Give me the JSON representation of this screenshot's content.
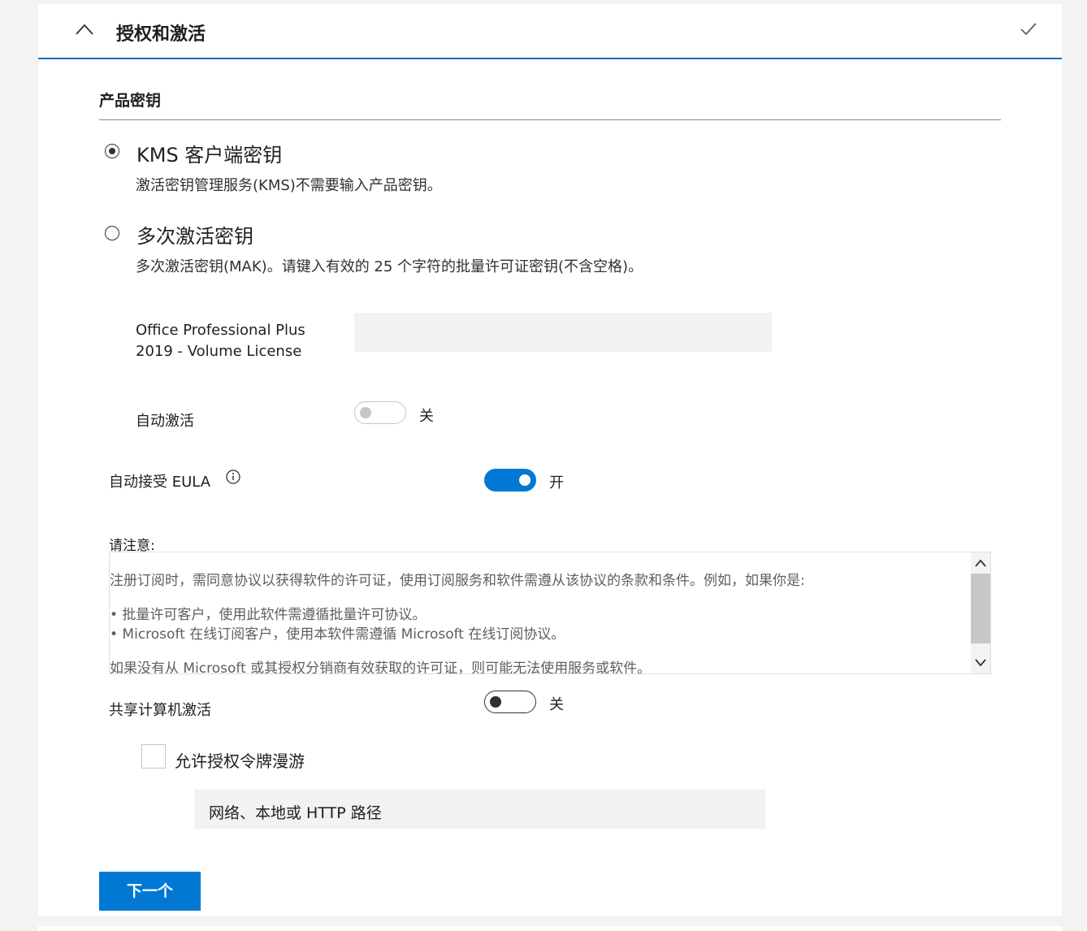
{
  "header": {
    "title": "授权和激活"
  },
  "product_key": {
    "section_title": "产品密钥",
    "options": [
      {
        "label": "KMS 客户端密钥",
        "description": "激活密钥管理服务(KMS)不需要输入产品密钥。",
        "selected": true
      },
      {
        "label": "多次激活密钥",
        "description": "多次激活密钥(MAK)。请键入有效的 25 个字符的批量许可证密钥(不含空格)。",
        "selected": false
      }
    ],
    "product_name_line1": "Office Professional Plus",
    "product_name_line2": "2019 - Volume License",
    "key_input_value": "",
    "auto_activate_label": "自动激活",
    "auto_activate_state": "关"
  },
  "eula": {
    "label": "自动接受 EULA",
    "state": "开"
  },
  "notice": {
    "title": "请注意:",
    "lines": [
      "注册订阅时，需同意协议以获得软件的许可证，使用订阅服务和软件需遵从该协议的条款和条件。例如，如果你是:",
      "• 批量许可客户，使用此软件需遵循批量许可协议。",
      "• Microsoft 在线订阅客户，使用本软件需遵循 Microsoft 在线订阅协议。",
      "如果没有从 Microsoft 或其授权分销商有效获取的许可证，则可能无法使用服务或软件。"
    ]
  },
  "shared_activation": {
    "label": "共享计算机激活",
    "state": "关",
    "roaming_label": "允许授权令牌漫游",
    "path_placeholder": "网络、本地或 HTTP 路径"
  },
  "footer": {
    "next_label": "下一个"
  }
}
